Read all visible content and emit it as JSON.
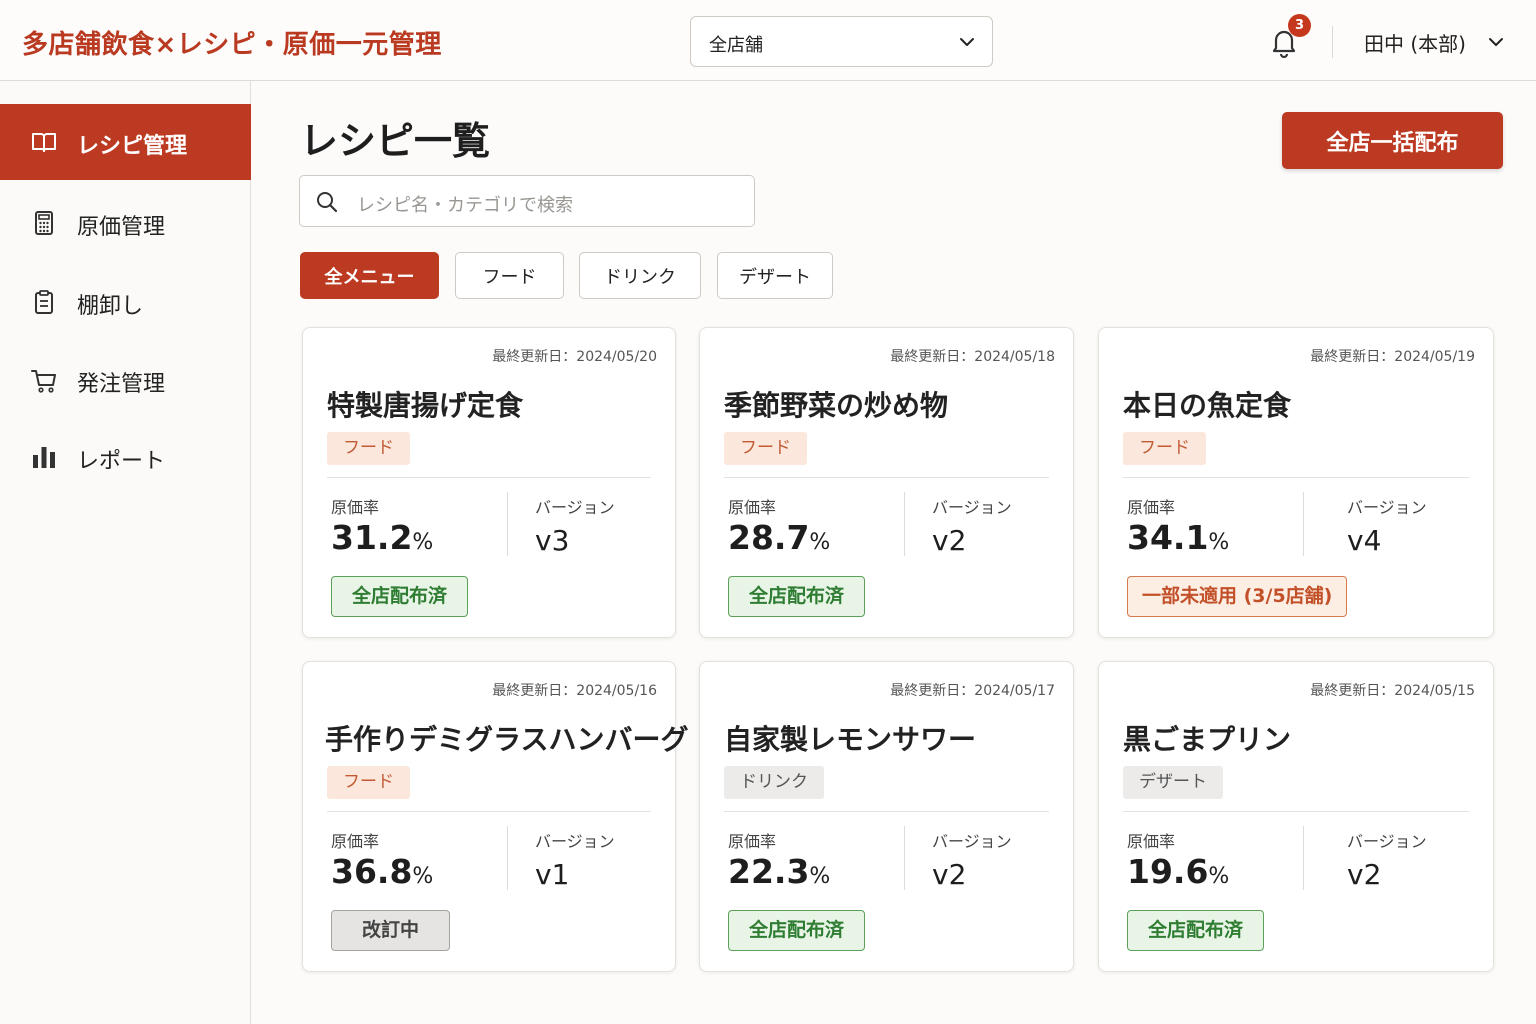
{
  "app": {
    "title": "多店舗飲食×レシピ・原価一元管理"
  },
  "header": {
    "store_select": "全店舗",
    "notification_count": "3",
    "user_name": "田中 (本部)"
  },
  "sidebar": {
    "items": [
      {
        "label": "レシピ管理",
        "icon": "book-icon",
        "active": true
      },
      {
        "label": "原価管理",
        "icon": "calculator-icon",
        "active": false
      },
      {
        "label": "棚卸し",
        "icon": "clipboard-icon",
        "active": false
      },
      {
        "label": "発注管理",
        "icon": "cart-icon",
        "active": false
      },
      {
        "label": "レポート",
        "icon": "bar-chart-icon",
        "active": false
      }
    ]
  },
  "main": {
    "title": "レシピ一覧",
    "bulk_button": "全店一括配布",
    "search_placeholder": "レシピ名・カテゴリで検索",
    "filters": [
      "全メニュー",
      "フード",
      "ドリンク",
      "デザート"
    ],
    "active_filter": "全メニュー"
  },
  "cards": [
    {
      "updated": "最終更新日：2024/05/20",
      "name": "特製唐揚げ定食",
      "category": "フード",
      "cost_label": "原価率",
      "cost": "31.2",
      "unit": "%",
      "version_label": "バージョン",
      "version": "v3",
      "status": "全店配布済"
    },
    {
      "updated": "最終更新日：2024/05/18",
      "name": "季節野菜の炒め物",
      "category": "フード",
      "cost_label": "原価率",
      "cost": "28.7",
      "unit": "%",
      "version_label": "バージョン",
      "version": "v2",
      "status": "全店配布済"
    },
    {
      "updated": "最終更新日：2024/05/19",
      "name": "本日の魚定食",
      "category": "フード",
      "cost_label": "原価率",
      "cost": "34.1",
      "unit": "%",
      "version_label": "バージョン",
      "version": "v4",
      "status": "一部未適用 (3/5店舗)"
    },
    {
      "updated": "最終更新日：2024/05/16",
      "name": "手作りデミグラスハンバーグ",
      "category": "フード",
      "cost_label": "原価率",
      "cost": "36.8",
      "unit": "%",
      "version_label": "バージョン",
      "version": "v1",
      "status": "改訂中"
    },
    {
      "updated": "最終更新日：2024/05/17",
      "name": "自家製レモンサワー",
      "category": "ドリンク",
      "cost_label": "原価率",
      "cost": "22.3",
      "unit": "%",
      "version_label": "バージョン",
      "version": "v2",
      "status": "全店配布済"
    },
    {
      "updated": "最終更新日：2024/05/15",
      "name": "黒ごまプリン",
      "category": "デザート",
      "cost_label": "原価率",
      "cost": "19.6",
      "unit": "%",
      "version_label": "バージョン",
      "version": "v2",
      "status": "全店配布済"
    }
  ],
  "colors": {
    "brand": "#bc3a22",
    "done": "#2f7d33",
    "partial": "#c2512a"
  }
}
